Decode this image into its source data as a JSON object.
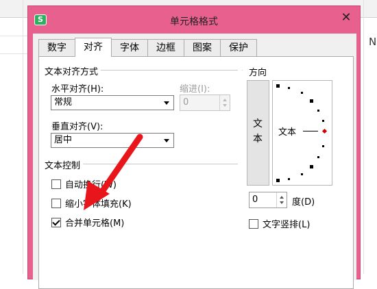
{
  "background": {
    "column_letter": "N"
  },
  "dialog": {
    "title": "单元格格式",
    "app_icon_text": "S",
    "close_symbol": "✕"
  },
  "tabs": [
    {
      "label": "数字"
    },
    {
      "label": "对齐",
      "active": true
    },
    {
      "label": "字体"
    },
    {
      "label": "边框"
    },
    {
      "label": "图案"
    },
    {
      "label": "保护"
    }
  ],
  "alignment": {
    "group_title": "文本对齐方式",
    "horizontal_label": "水平对齐(H):",
    "horizontal_value": "常规",
    "indent_label": "缩进(I):",
    "indent_value": "0",
    "vertical_label": "垂直对齐(V):",
    "vertical_value": "居中"
  },
  "text_control": {
    "group_title": "文本控制",
    "wrap_label": "自动换行(W)",
    "wrap_checked": false,
    "shrink_label": "缩小字体填充(K)",
    "shrink_checked": false,
    "merge_label": "合并单元格(M)",
    "merge_checked": true
  },
  "orientation": {
    "group_title": "方向",
    "vertical_text_char1": "文",
    "vertical_text_char2": "本",
    "dial_text": "文本",
    "degree_value": "0",
    "degree_label": "度(D)",
    "vertical_text_label": "文字竖排(L)",
    "vertical_text_checked": false
  },
  "colors": {
    "dialog_frame": "#e8608e",
    "annotation_arrow": "#e8161b",
    "dial_marker": "#d40000"
  }
}
